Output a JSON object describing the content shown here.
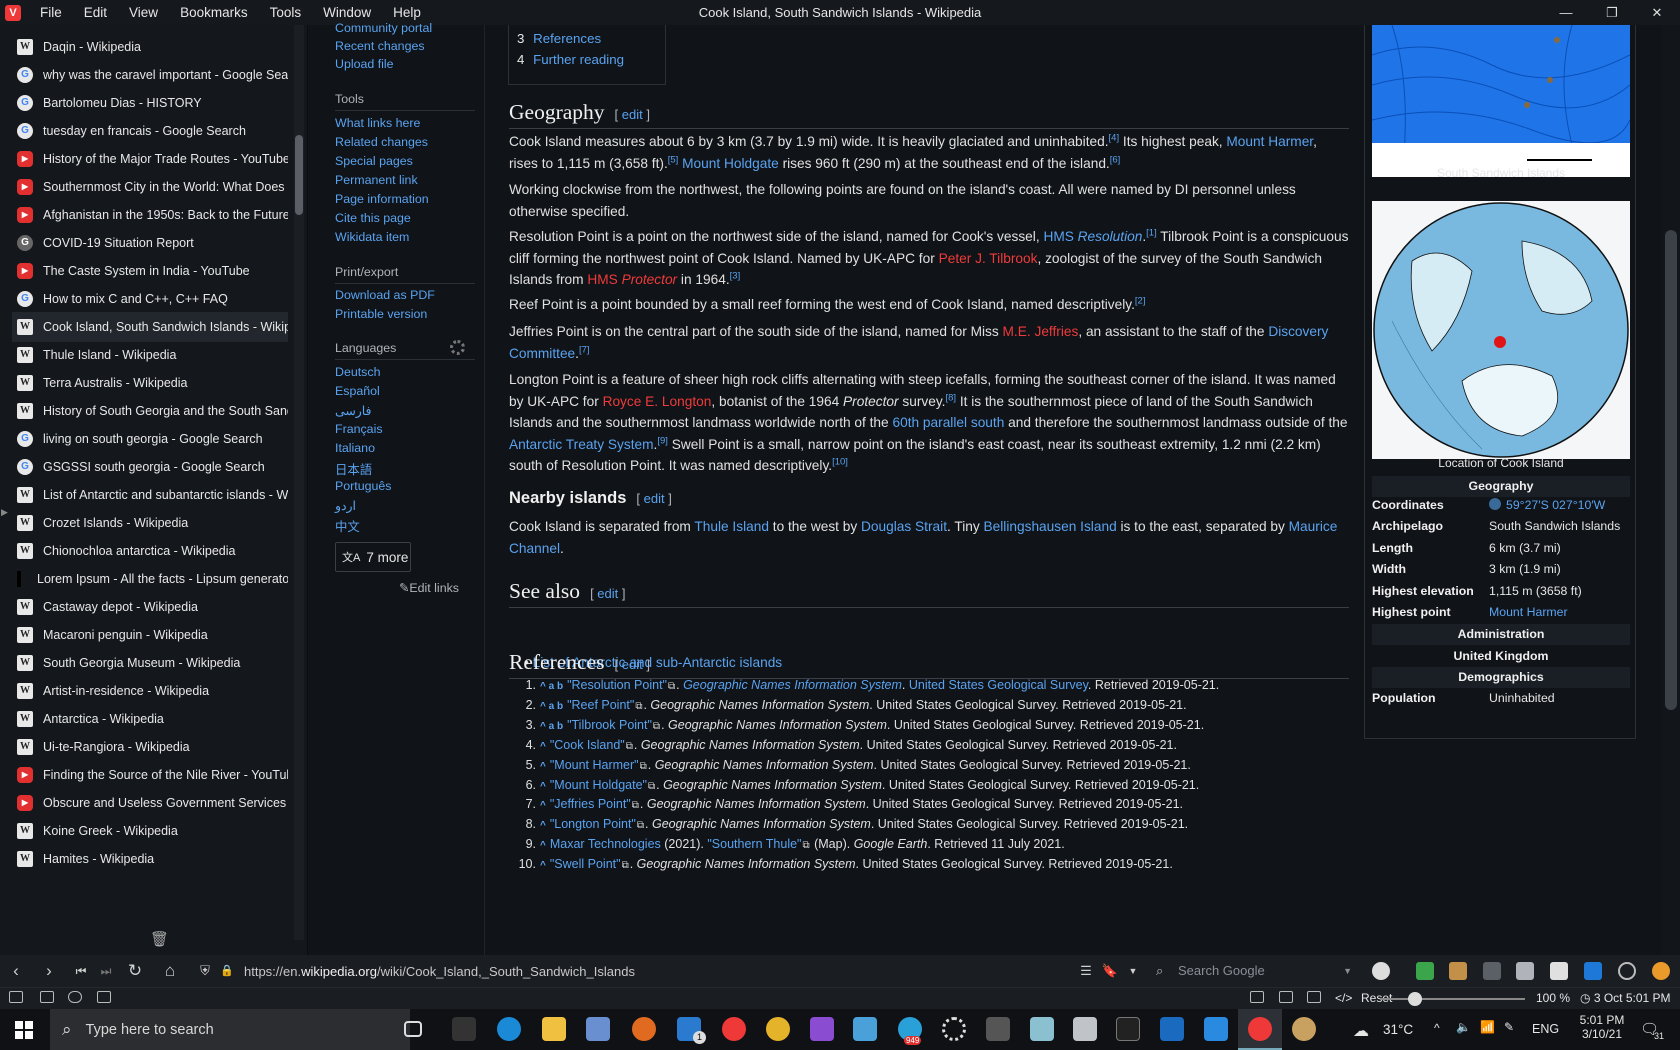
{
  "menubar": {
    "items": [
      "File",
      "Edit",
      "View",
      "Bookmarks",
      "Tools",
      "Window",
      "Help"
    ],
    "window_title": "Cook Island, South Sandwich Islands - Wikipedia"
  },
  "tabs": [
    {
      "title": "Daqin - Wikipedia",
      "icon": "W",
      "kind": "w"
    },
    {
      "title": "why was the caravel important - Google Search",
      "icon": "G",
      "kind": "g"
    },
    {
      "title": "Bartolomeu Dias - HISTORY",
      "icon": "G",
      "kind": "g"
    },
    {
      "title": "tuesday en francais - Google Search",
      "icon": "G",
      "kind": "g"
    },
    {
      "title": "History of the Major Trade Routes - YouTube",
      "icon": "▶",
      "kind": "y"
    },
    {
      "title": "Southernmost City in the World: What Does It Look",
      "icon": "▶",
      "kind": "y"
    },
    {
      "title": "Afghanistan in the 1950s: Back to the Future [Full",
      "icon": "▶",
      "kind": "y"
    },
    {
      "title": "COVID-19 Situation Report",
      "icon": "G",
      "kind": "d"
    },
    {
      "title": "The Caste System in India - YouTube",
      "icon": "▶",
      "kind": "y"
    },
    {
      "title": "How to mix C and C++, C++ FAQ",
      "icon": "G",
      "kind": "g"
    },
    {
      "title": "Cook Island, South Sandwich Islands - Wikipedia",
      "icon": "W",
      "kind": "w",
      "active": true
    },
    {
      "title": "Thule Island - Wikipedia",
      "icon": "W",
      "kind": "w"
    },
    {
      "title": "Terra Australis - Wikipedia",
      "icon": "W",
      "kind": "w"
    },
    {
      "title": "History of South Georgia and the South Sandwich",
      "icon": "W",
      "kind": "w"
    },
    {
      "title": "living on south georgia - Google Search",
      "icon": "G",
      "kind": "g"
    },
    {
      "title": "GSGSSI south georgia - Google Search",
      "icon": "G",
      "kind": "g"
    },
    {
      "title": "List of Antarctic and subantarctic islands - Wikipedia",
      "icon": "W",
      "kind": "w"
    },
    {
      "title": "Crozet Islands - Wikipedia",
      "icon": "W",
      "kind": "w"
    },
    {
      "title": "Chionochloa antarctica - Wikipedia",
      "icon": "W",
      "kind": "w"
    },
    {
      "title": "Lorem Ipsum - All the facts - Lipsum generator",
      "icon": "",
      "kind": "l"
    },
    {
      "title": "Castaway depot - Wikipedia",
      "icon": "W",
      "kind": "w"
    },
    {
      "title": "Macaroni penguin - Wikipedia",
      "icon": "W",
      "kind": "w"
    },
    {
      "title": "South Georgia Museum - Wikipedia",
      "icon": "W",
      "kind": "w"
    },
    {
      "title": "Artist-in-residence - Wikipedia",
      "icon": "W",
      "kind": "w"
    },
    {
      "title": "Antarctica - Wikipedia",
      "icon": "W",
      "kind": "w"
    },
    {
      "title": "Ui-te-Rangiora - Wikipedia",
      "icon": "W",
      "kind": "w"
    },
    {
      "title": "Finding the Source of the Nile River - YouTube",
      "icon": "▶",
      "kind": "y"
    },
    {
      "title": "Obscure and Useless Government Services - YouTube",
      "icon": "▶",
      "kind": "y"
    },
    {
      "title": "Koine Greek - Wikipedia",
      "icon": "W",
      "kind": "w"
    },
    {
      "title": "Hamites - Wikipedia",
      "icon": "W",
      "kind": "w"
    }
  ],
  "wikinav": {
    "top_links": [
      "Community portal",
      "Recent changes",
      "Upload file"
    ],
    "tools_heading": "Tools",
    "tools": [
      "What links here",
      "Related changes",
      "Special pages",
      "Permanent link",
      "Page information",
      "Cite this page",
      "Wikidata item"
    ],
    "print_heading": "Print/export",
    "print": [
      "Download as PDF",
      "Printable version"
    ],
    "languages_heading": "Languages",
    "languages": [
      "Deutsch",
      "Español",
      "فارسی",
      "Français",
      "Italiano",
      "日本語",
      "Português",
      "اردو",
      "中文"
    ],
    "more_label": "7 more",
    "more_icon": "文A",
    "edit_links": "Edit links",
    "edit_links_icon": "✎"
  },
  "toc": {
    "items": [
      {
        "num": "3",
        "label": "References"
      },
      {
        "num": "4",
        "label": "Further reading"
      }
    ]
  },
  "article": {
    "edit_label": "edit",
    "geography_heading": "Geography",
    "nearby_heading": "Nearby islands",
    "seealso_heading": "See also",
    "seealso_items": [
      "List of Antarctic and sub-Antarctic islands"
    ],
    "references_heading": "References"
  },
  "references": [
    {
      "num": "1.",
      "marks": "^ a b",
      "title": "\"Resolution Point\"",
      "source": "Geographic Names Information System",
      "sep": ". ",
      "publisher": "United States Geological Survey",
      "retrieved": ". Retrieved 2019-05-21.",
      "linked": true
    },
    {
      "num": "2.",
      "marks": "^ a b",
      "title": "\"Reef Point\"",
      "source": "Geographic Names Information System",
      "sep": ". ",
      "publisher": "United States Geological Survey",
      "retrieved": ". Retrieved 2019-05-21.",
      "linked": false
    },
    {
      "num": "3.",
      "marks": "^ a b",
      "title": "\"Tilbrook Point\"",
      "source": "Geographic Names Information System",
      "sep": ". ",
      "publisher": "United States Geological Survey",
      "retrieved": ". Retrieved 2019-05-21.",
      "linked": false
    },
    {
      "num": "4.",
      "marks": "^",
      "title": "\"Cook Island\"",
      "source": "Geographic Names Information System",
      "sep": ". ",
      "publisher": "United States Geological Survey",
      "retrieved": ". Retrieved 2019-05-21.",
      "linked": false
    },
    {
      "num": "5.",
      "marks": "^",
      "title": "\"Mount Harmer\"",
      "source": "Geographic Names Information System",
      "sep": ". ",
      "publisher": "United States Geological Survey",
      "retrieved": ". Retrieved 2019-05-21.",
      "linked": false
    },
    {
      "num": "6.",
      "marks": "^",
      "title": "\"Mount Holdgate\"",
      "source": "Geographic Names Information System",
      "sep": ". ",
      "publisher": "United States Geological Survey",
      "retrieved": ". Retrieved 2019-05-21.",
      "linked": false
    },
    {
      "num": "7.",
      "marks": "^",
      "title": "\"Jeffries Point\"",
      "source": "Geographic Names Information System",
      "sep": ". ",
      "publisher": "United States Geological Survey",
      "retrieved": ". Retrieved 2019-05-21.",
      "linked": false
    },
    {
      "num": "8.",
      "marks": "^",
      "title": "\"Longton Point\"",
      "source": "Geographic Names Information System",
      "sep": ". ",
      "publisher": "United States Geological Survey",
      "retrieved": ". Retrieved 2019-05-21.",
      "linked": false
    },
    {
      "num": "9.",
      "marks": "^",
      "title": "\"Southern Thule\"",
      "source": "Google Earth",
      "sep": ". ",
      "publisher": "",
      "retrieved": ". Retrieved 11 July 2021.",
      "prefix_link": "Maxar Technologies",
      "prefix_text": " (2021). ",
      "suffix_text": " (Map). ",
      "linked": false
    },
    {
      "num": "10.",
      "marks": "^",
      "title": "\"Swell Point\"",
      "source": "Geographic Names Information System",
      "sep": ". ",
      "publisher": "United States Geological Survey",
      "retrieved": ". Retrieved 2019-05-21.",
      "linked": false
    }
  ],
  "infobox": {
    "map_caption": "South Sandwich Islands",
    "globe_caption": "Location of Cook Island",
    "geography_heading": "Geography",
    "rows": [
      {
        "label": "Coordinates",
        "value": "59°27′S 027°10′W",
        "link": true,
        "icon": "globe-icon"
      },
      {
        "label": "Archipelago",
        "value": "South Sandwich Islands",
        "link": false
      },
      {
        "label": "Length",
        "value": "6 km (3.7 mi)",
        "link": false
      },
      {
        "label": "Width",
        "value": "3 km (1.9 mi)",
        "link": false
      },
      {
        "label": "Highest elevation",
        "value": "1,115 m (3658 ft)",
        "link": false
      },
      {
        "label": "Highest point",
        "value": "Mount Harmer",
        "link": true
      }
    ],
    "administration_heading": "Administration",
    "administration_value": "United Kingdom",
    "demographics_heading": "Demographics",
    "population_label": "Population",
    "population_value": "Uninhabited"
  },
  "addressbar": {
    "url_prefix": "https://en.",
    "url_domain": "wikipedia.org",
    "url_path": "/wiki/Cook_Island,_South_Sandwich_Islands",
    "search_placeholder": "Search Google"
  },
  "statusbar": {
    "reset_label": "Reset",
    "zoom": "100 %",
    "zoom_fraction": 0.24,
    "clock": "3 Oct  5:01 PM"
  },
  "taskbar": {
    "search_placeholder": "Type here to search",
    "weather": "31°C",
    "lang": "ENG",
    "time": "5:01 PM",
    "date": "3/10/21",
    "notifications": "31",
    "telegram_badge": "949",
    "mail_badge": "1"
  },
  "colors": {
    "link": "#5aa3f0",
    "redlink": "#ef3b3b",
    "accent": "#ef3939"
  }
}
